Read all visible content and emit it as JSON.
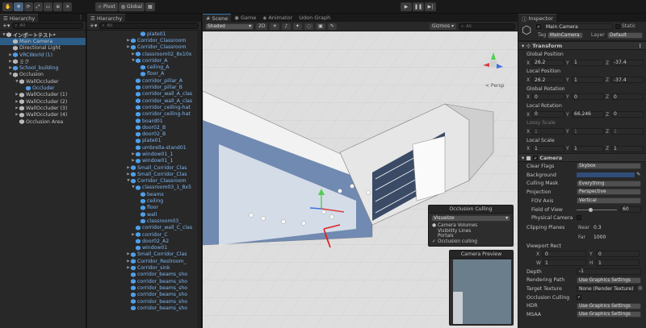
{
  "toolbar": {
    "pivot_label": "Pivot",
    "global_label": "Global"
  },
  "hierarchy": {
    "tab_label": "Hierarchy",
    "search_placeholder": "All",
    "items": [
      {
        "label": "インポートテスト*",
        "depth": 0,
        "arrow": "▼",
        "icon": "scene",
        "sel": false,
        "prefab": false,
        "bold": true
      },
      {
        "label": "Main Camera",
        "depth": 1,
        "arrow": "",
        "icon": "cube",
        "sel": true,
        "prefab": false
      },
      {
        "label": "Directional Light",
        "depth": 1,
        "arrow": "",
        "icon": "cube",
        "sel": false,
        "prefab": false
      },
      {
        "label": "VRCWorld (1)",
        "depth": 1,
        "arrow": "▶",
        "icon": "cube-blue",
        "sel": false,
        "prefab": true
      },
      {
        "label": "ミク",
        "depth": 1,
        "arrow": "▶",
        "icon": "cube",
        "sel": false,
        "prefab": false
      },
      {
        "label": "School_building",
        "depth": 1,
        "arrow": "▶",
        "icon": "cube-blue",
        "sel": false,
        "prefab": true
      },
      {
        "label": "Occlusion",
        "depth": 1,
        "arrow": "▼",
        "icon": "cube",
        "sel": false,
        "prefab": false
      },
      {
        "label": "WallOccluder",
        "depth": 2,
        "arrow": "▼",
        "icon": "cube",
        "sel": false,
        "prefab": false
      },
      {
        "label": "Occluder",
        "depth": 3,
        "arrow": "",
        "icon": "cube-blue",
        "sel": false,
        "prefab": true
      },
      {
        "label": "WallOccluder (1)",
        "depth": 2,
        "arrow": "▶",
        "icon": "cube",
        "sel": false,
        "prefab": false
      },
      {
        "label": "WallOccluder (2)",
        "depth": 2,
        "arrow": "▶",
        "icon": "cube",
        "sel": false,
        "prefab": false
      },
      {
        "label": "WallOccluder (3)",
        "depth": 2,
        "arrow": "▶",
        "icon": "cube",
        "sel": false,
        "prefab": false
      },
      {
        "label": "WallOccluder (4)",
        "depth": 2,
        "arrow": "▶",
        "icon": "cube",
        "sel": false,
        "prefab": false
      },
      {
        "label": "Occlusion Area",
        "depth": 2,
        "arrow": "",
        "icon": "cube",
        "sel": false,
        "prefab": false
      }
    ]
  },
  "hierarchy2": {
    "tab_label": "Hierarchy",
    "search_placeholder": "All",
    "items": [
      {
        "label": "plate01",
        "depth": 3,
        "arrow": "",
        "prefab": true
      },
      {
        "label": "Corridor_Classroom",
        "depth": 1,
        "arrow": "▶",
        "prefab": true
      },
      {
        "label": "Corridor_Classroom",
        "depth": 1,
        "arrow": "▶",
        "prefab": true
      },
      {
        "label": "classroom02_8x10x",
        "depth": 2,
        "arrow": "▶",
        "prefab": true
      },
      {
        "label": "corridor_A",
        "depth": 2,
        "arrow": "▼",
        "prefab": true
      },
      {
        "label": "ceiling_A",
        "depth": 3,
        "arrow": "",
        "prefab": true
      },
      {
        "label": "floor_A",
        "depth": 3,
        "arrow": "",
        "prefab": true
      },
      {
        "label": "corridor_pillar_A",
        "depth": 2,
        "arrow": "",
        "prefab": true
      },
      {
        "label": "corridor_pillar_B",
        "depth": 2,
        "arrow": "",
        "prefab": true
      },
      {
        "label": "corridor_wall_A_clas",
        "depth": 2,
        "arrow": "",
        "prefab": true
      },
      {
        "label": "corridor_wall_A_clas",
        "depth": 2,
        "arrow": "",
        "prefab": true
      },
      {
        "label": "corridor_ceiling-hat",
        "depth": 2,
        "arrow": "",
        "prefab": true
      },
      {
        "label": "corridor_ceiling-hat",
        "depth": 2,
        "arrow": "",
        "prefab": true
      },
      {
        "label": "board01",
        "depth": 2,
        "arrow": "",
        "prefab": true
      },
      {
        "label": "door02_B",
        "depth": 2,
        "arrow": "",
        "prefab": true
      },
      {
        "label": "door02_B",
        "depth": 2,
        "arrow": "",
        "prefab": true
      },
      {
        "label": "plate01",
        "depth": 2,
        "arrow": "",
        "prefab": true
      },
      {
        "label": "umbrella-stand01",
        "depth": 2,
        "arrow": "",
        "prefab": true
      },
      {
        "label": "window01_1",
        "depth": 2,
        "arrow": "▶",
        "prefab": true
      },
      {
        "label": "window01_1",
        "depth": 2,
        "arrow": "▶",
        "prefab": true
      },
      {
        "label": "Small_Corridor_Clas",
        "depth": 1,
        "arrow": "▶",
        "prefab": true
      },
      {
        "label": "Small_Corridor_Clas",
        "depth": 1,
        "arrow": "▶",
        "prefab": true
      },
      {
        "label": "Corridor_Classroom",
        "depth": 1,
        "arrow": "▼",
        "prefab": true
      },
      {
        "label": "classroom03_1_8x5",
        "depth": 2,
        "arrow": "▼",
        "prefab": true
      },
      {
        "label": "beams",
        "depth": 3,
        "arrow": "",
        "prefab": true
      },
      {
        "label": "ceiling",
        "depth": 3,
        "arrow": "",
        "prefab": true
      },
      {
        "label": "floor",
        "depth": 3,
        "arrow": "",
        "prefab": true
      },
      {
        "label": "wall",
        "depth": 3,
        "arrow": "",
        "prefab": true
      },
      {
        "label": "classroom03_",
        "depth": 3,
        "arrow": "",
        "prefab": true
      },
      {
        "label": "corridor_wall_C_clas",
        "depth": 2,
        "arrow": "",
        "prefab": true
      },
      {
        "label": "corridor_C",
        "depth": 2,
        "arrow": "▶",
        "prefab": true
      },
      {
        "label": "door02_A2",
        "depth": 2,
        "arrow": "",
        "prefab": true
      },
      {
        "label": "window01",
        "depth": 2,
        "arrow": "",
        "prefab": true
      },
      {
        "label": "Small_Corridor_Clas",
        "depth": 1,
        "arrow": "▶",
        "prefab": true
      },
      {
        "label": "Corridor_Restroom_",
        "depth": 1,
        "arrow": "▶",
        "prefab": true
      },
      {
        "label": "Corridor_sink",
        "depth": 1,
        "arrow": "▶",
        "prefab": true
      },
      {
        "label": "corridor_beams_sho",
        "depth": 1,
        "arrow": "",
        "prefab": true
      },
      {
        "label": "corridor_beams_sho",
        "depth": 1,
        "arrow": "",
        "prefab": true
      },
      {
        "label": "corridor_beams_sho",
        "depth": 1,
        "arrow": "",
        "prefab": true
      },
      {
        "label": "corridor_beams_sho",
        "depth": 1,
        "arrow": "",
        "prefab": true
      },
      {
        "label": "corridor_beams_sho",
        "depth": 1,
        "arrow": "",
        "prefab": true
      },
      {
        "label": "corridor_beams_sho",
        "depth": 1,
        "arrow": "",
        "prefab": true
      }
    ]
  },
  "scene": {
    "tabs": [
      "Scene",
      "Game",
      "Animator",
      "Udon Graph"
    ],
    "shading": "Shaded",
    "mode_2d": "2D",
    "gizmos": "Gizmos",
    "search_placeholder": "All",
    "persp_label": "< Persp"
  },
  "occlusion_culling": {
    "title": "Occlusion Culling",
    "dropdown": "Visualize",
    "options": [
      {
        "label": "Camera Volumes",
        "state": "●"
      },
      {
        "label": "Visibility Lines",
        "state": ""
      },
      {
        "label": "Portals",
        "state": ""
      },
      {
        "label": "Occlusion culling",
        "state": "✓"
      }
    ]
  },
  "camera_preview": {
    "title": "Camera Preview"
  },
  "inspector": {
    "tab_label": "Inspector",
    "object_name": "Main Camera",
    "static_label": "Static",
    "tag_label": "Tag",
    "tag_value": "MainCamera",
    "layer_label": "Layer",
    "layer_value": "Default",
    "transform": {
      "title": "Transform",
      "global_position": {
        "label": "Global Position",
        "x": "26.2",
        "y": "1",
        "z": "-37.4"
      },
      "local_position": {
        "label": "Local Position",
        "x": "26.2",
        "y": "1",
        "z": "-37.4"
      },
      "global_rotation": {
        "label": "Global Rotation",
        "x": "0",
        "y": "0",
        "z": "0"
      },
      "local_rotation": {
        "label": "Local Rotation",
        "x": "0",
        "y": "66.246",
        "z": "0"
      },
      "lossy_scale": {
        "label": "Lossy Scale",
        "x": "1",
        "y": "1",
        "z": "1"
      },
      "local_scale": {
        "label": "Local Scale",
        "x": "1",
        "y": "1",
        "z": "1"
      }
    },
    "camera": {
      "title": "Camera",
      "clear_flags": {
        "label": "Clear Flags",
        "value": "Skybox"
      },
      "background": {
        "label": "Background",
        "color": "#314d79"
      },
      "culling_mask": {
        "label": "Culling Mask",
        "value": "Everything"
      },
      "projection": {
        "label": "Projection",
        "value": "Perspective"
      },
      "fov_axis": {
        "label": "FOV Axis",
        "value": "Vertical"
      },
      "field_of_view": {
        "label": "Field of View",
        "value": "60",
        "fraction": 0.33
      },
      "physical_camera": {
        "label": "Physical Camera"
      },
      "clipping_planes": {
        "label": "Clipping Planes",
        "near_label": "Near",
        "near": "0.3",
        "far_label": "Far",
        "far": "1000"
      },
      "viewport_rect": {
        "label": "Viewport Rect",
        "x": "0",
        "y": "0",
        "w": "1",
        "h": "1"
      },
      "depth": {
        "label": "Depth",
        "value": "-1"
      },
      "rendering_path": {
        "label": "Rendering Path",
        "value": "Use Graphics Settings"
      },
      "target_texture": {
        "label": "Target Texture",
        "value": "None (Render Texture)"
      },
      "occlusion_culling": {
        "label": "Occlusion Culling"
      },
      "hdr": {
        "label": "HDR",
        "value": "Use Graphics Settings"
      },
      "msaa": {
        "label": "MSAA",
        "value": "Use Graphics Settings"
      }
    }
  },
  "colors": {
    "selection": "#2c5d87",
    "prefab": "#7fb6f0",
    "accent": "#3a79bb"
  }
}
